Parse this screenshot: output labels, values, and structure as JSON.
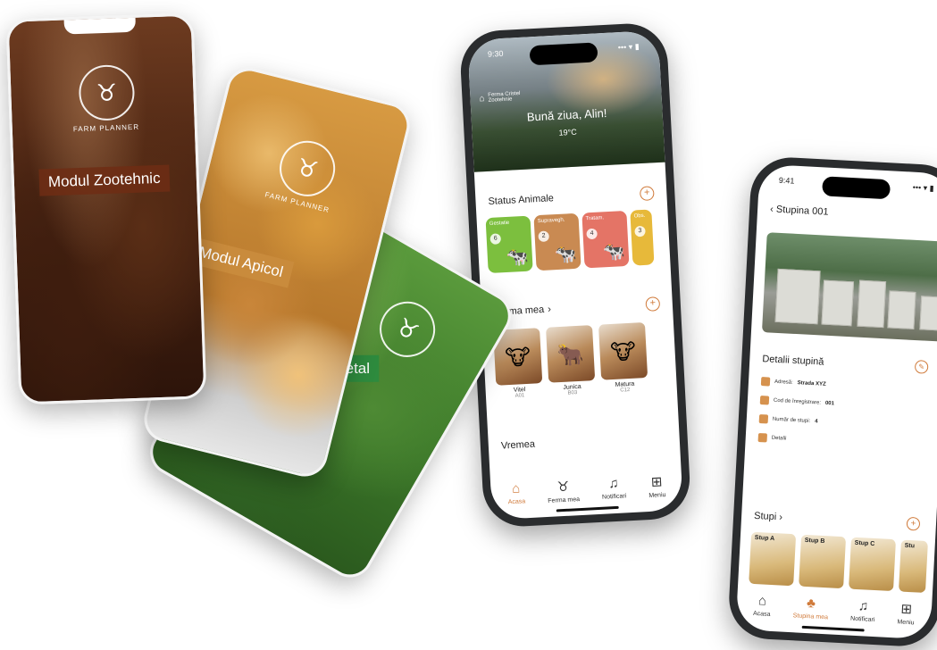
{
  "cards": {
    "zoo": {
      "label": "Modul Zootehnic",
      "logo_text": "FARM PLANNER"
    },
    "api": {
      "label": "Modul Apicol",
      "logo_text": "FARM PLANNER"
    },
    "veg": {
      "label": "Modul Vegetal"
    }
  },
  "main_phone": {
    "status_time": "9:30",
    "status_icons": "••• ▾ ▮",
    "farm_name": "Ferma Cristel",
    "farm_sub": "Zootehnie",
    "greeting": "Bună ziua, Alin!",
    "temperature": "19°C",
    "status_title": "Status Animale",
    "status_tiles": [
      {
        "label": "Gestatie",
        "count": "6",
        "color": "#7cbf3e"
      },
      {
        "label": "Supravegh.",
        "count": "2",
        "color": "#c98a52"
      },
      {
        "label": "Tratam.",
        "count": "4",
        "color": "#e47466"
      },
      {
        "label": "Obs.",
        "count": "3",
        "color": "#e7b93a"
      }
    ],
    "farm_title": "Ferma mea",
    "farm_animals": [
      {
        "name": "Vitel",
        "code": "A01"
      },
      {
        "name": "Junica",
        "code": "B03"
      },
      {
        "name": "Matura",
        "code": "C12"
      }
    ],
    "weather_title": "Vremea",
    "tabs": [
      {
        "label": "Acasa",
        "icon": "⌂"
      },
      {
        "label": "Ferma mea",
        "icon": "♉"
      },
      {
        "label": "Notificari",
        "icon": "♫"
      },
      {
        "label": "Meniu",
        "icon": "⊞"
      }
    ]
  },
  "hive_phone": {
    "status_time": "9:41",
    "status_icons": "••• ▾ ▮",
    "title": "Stupina 001",
    "details_title": "Detalii stupină",
    "details": [
      {
        "label": "Adresă:",
        "value": "Strada XYZ"
      },
      {
        "label": "Cod de înregistrare:",
        "value": "001"
      },
      {
        "label": "Număr de stupi:",
        "value": "4"
      },
      {
        "label": "Detalii",
        "value": ""
      }
    ],
    "hives_title": "Stupi",
    "hives": [
      "Stup A",
      "Stup B",
      "Stup C",
      "Stu"
    ],
    "tabs": [
      {
        "label": "Acasa",
        "icon": "⌂"
      },
      {
        "label": "Stupina mea",
        "icon": "♣"
      },
      {
        "label": "Notificari",
        "icon": "♫"
      },
      {
        "label": "Meniu",
        "icon": "⊞"
      }
    ]
  },
  "colors": {
    "accent": "#d07a3a",
    "vegetal": "#2e8b3e",
    "apicol": "#c98b3c",
    "zootehnic": "#6e2d14"
  }
}
